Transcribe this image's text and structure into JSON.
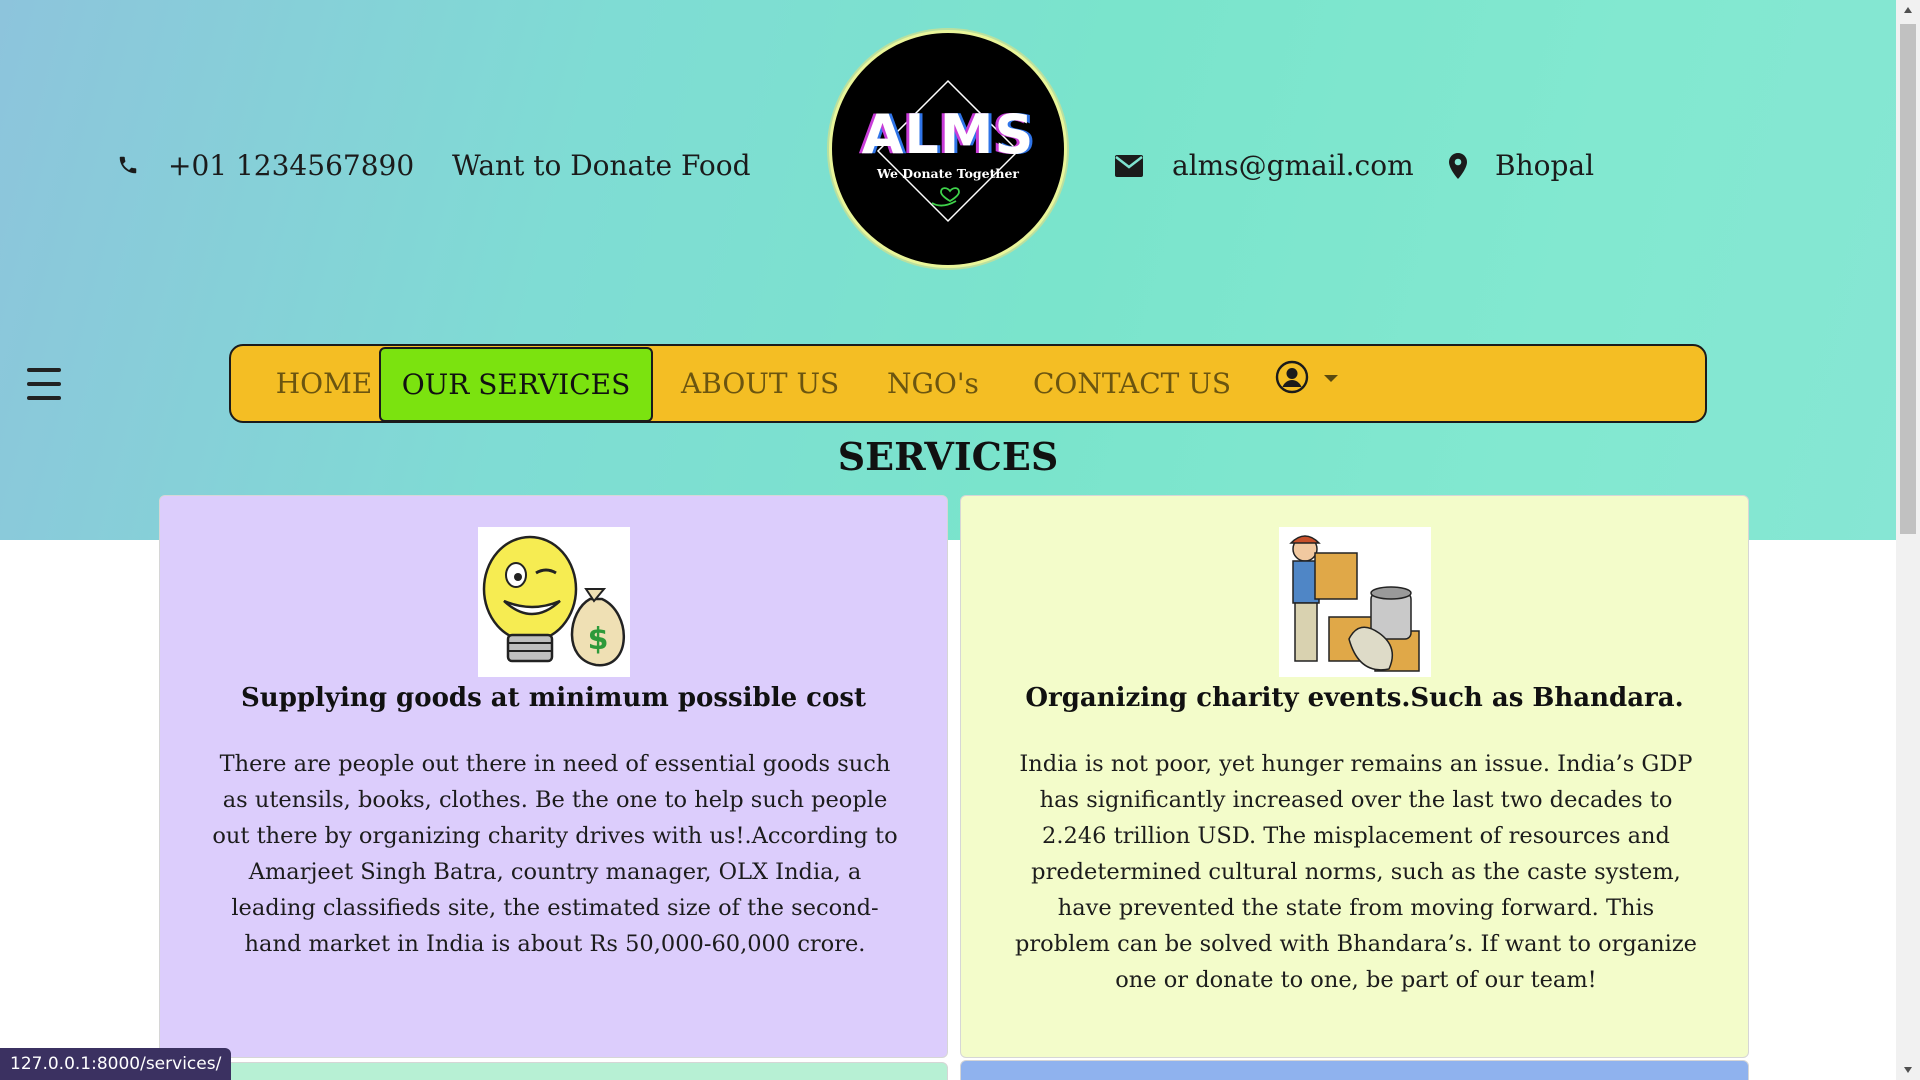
{
  "topbar": {
    "phone": "+01 1234567890",
    "donate_text": "Want to Donate Food",
    "email": "alms@gmail.com",
    "location": "Bhopal"
  },
  "logo": {
    "title": "ALMS",
    "tagline": "We Donate Together"
  },
  "nav": {
    "items": [
      {
        "label": "HOME"
      },
      {
        "label": "OUR SERVICES"
      },
      {
        "label": "ABOUT US"
      },
      {
        "label": "NGO's"
      },
      {
        "label": "CONTACT US"
      }
    ],
    "active_index": 1
  },
  "page": {
    "heading": "SERVICES"
  },
  "cards": [
    {
      "title": "Supplying goods at minimum possible cost",
      "lines": [
        "There are people out there in need of essential goods such",
        "as utensils, books, clothes. Be the one to help such people",
        "out there by organizing charity drives with us!.According to",
        "Amarjeet Singh Batra, country manager, OLX India, a",
        "leading classifieds site, the estimated size of the second-",
        "hand market in India is about Rs 50,000-60,000 crore."
      ],
      "background": "#dccdfc"
    },
    {
      "title": "Organizing charity events.Such as Bhandara.",
      "lines": [
        "India is not poor, yet hunger remains an issue. India’s GDP",
        "has significantly increased over the last two decades to",
        "2.246 trillion USD. The misplacement of resources and",
        "predetermined cultural norms, such as the caste system,",
        "have prevented the state from moving forward. This",
        "problem can be solved with Bhandara’s. If want to organize",
        "one or donate to one, be part of our team!"
      ],
      "background": "#f3fcca"
    }
  ],
  "colors": {
    "nav_bg": "#f4be24",
    "nav_active": "#7be30f",
    "card3_bg": "#b7f0d4",
    "card4_bg": "#8fb2ee"
  },
  "status": {
    "url": "127.0.0.1:8000/services/"
  },
  "icons": [
    "phone-icon",
    "envelope-icon",
    "map-marker-icon",
    "user-circle-icon",
    "caret-down-icon",
    "hamburger-menu-icon"
  ]
}
